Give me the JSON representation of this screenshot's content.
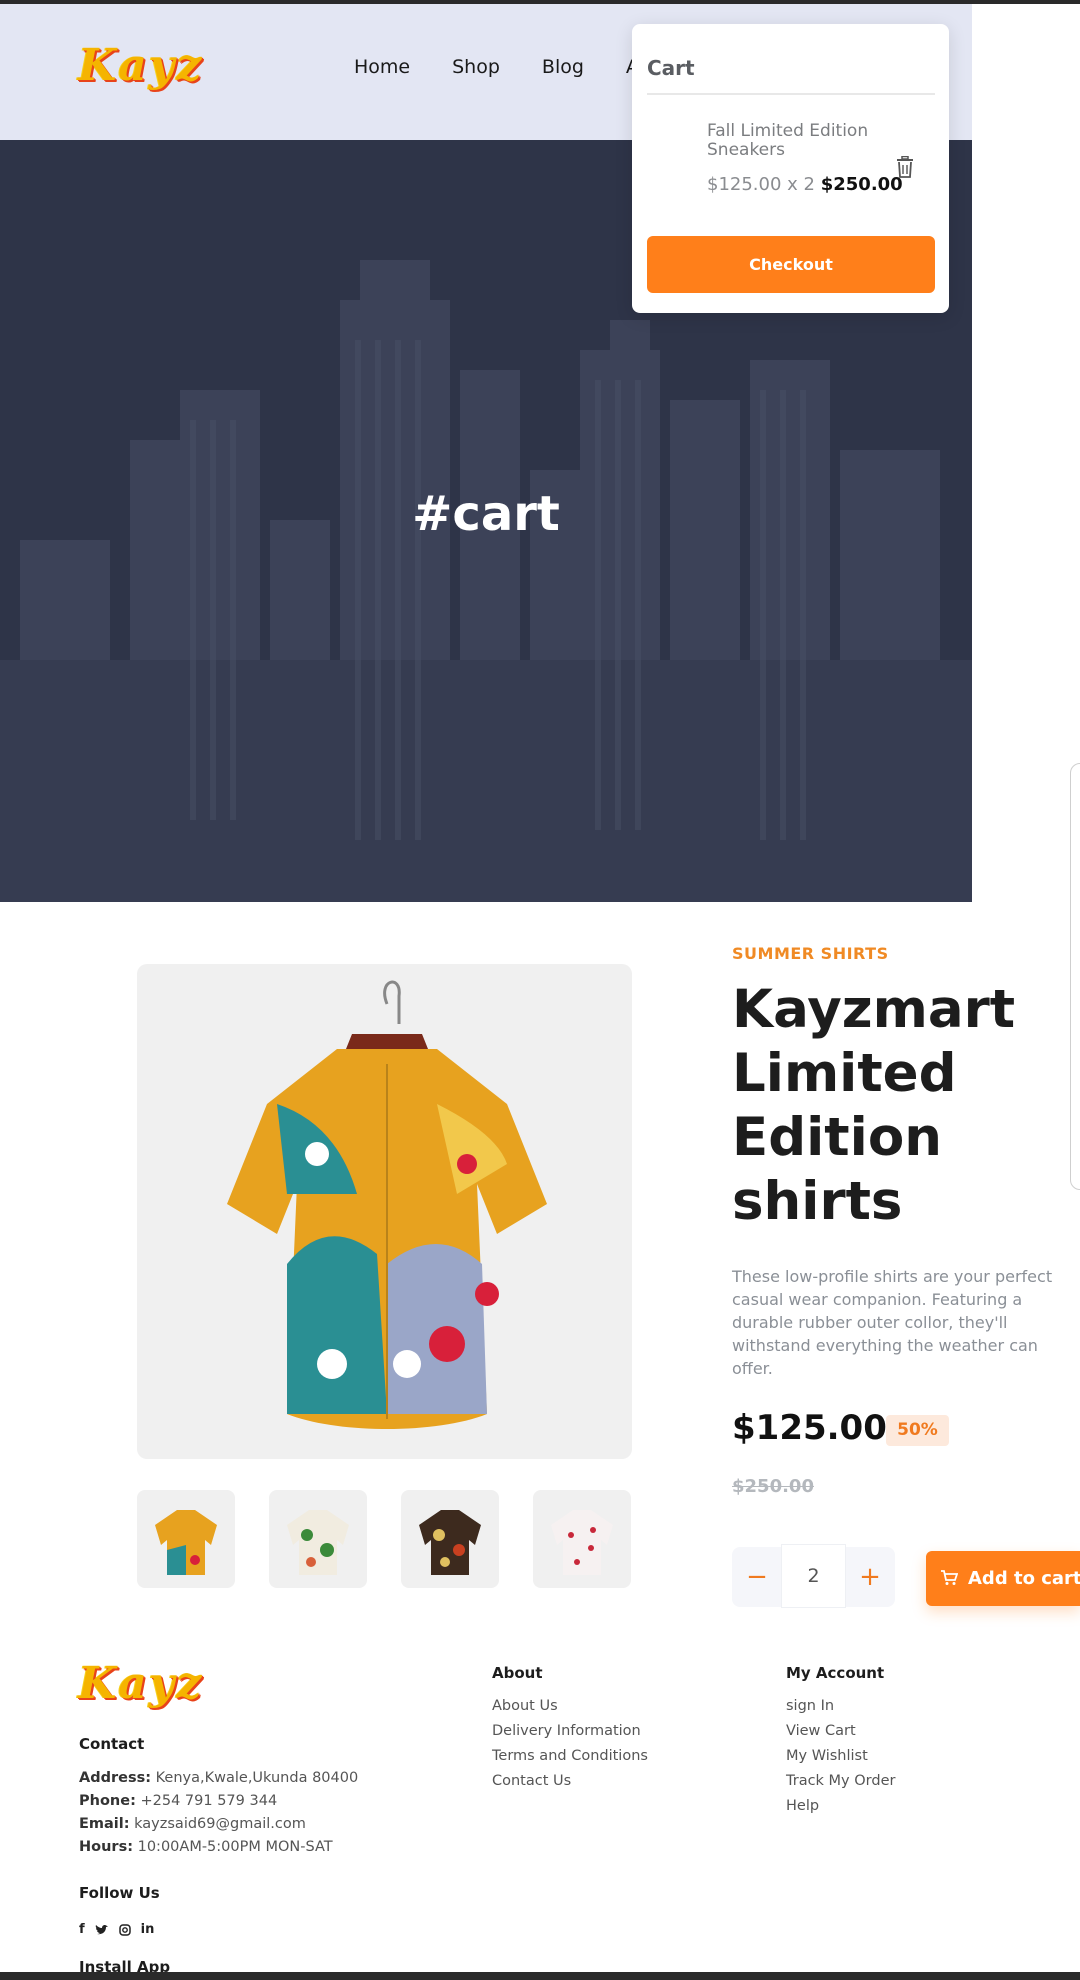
{
  "brand": {
    "logo_text": "Kayz"
  },
  "nav": {
    "items": [
      "Home",
      "Shop",
      "Blog",
      "About"
    ]
  },
  "hero": {
    "title": "#cart"
  },
  "cart": {
    "title": "Cart",
    "item_name": "Fall Limited Edition Sneakers",
    "item_unit": "$125.00 x 2",
    "item_total": "$250.00",
    "checkout_label": "Checkout"
  },
  "product": {
    "category": "SUMMER SHIRTS",
    "title": "Kayzmart Limited Edition shirts",
    "description": "These low-profile shirts are your perfect casual wear companion. Featuring a durable rubber outer collor, they'll withstand everything the weather can offer.",
    "price": "$125.00",
    "discount": "50%",
    "old_price": "$250.00",
    "quantity": "2",
    "add_to_cart_label": "Add to cart",
    "thumbnails": [
      "colorful-shirt-icon",
      "green-leaf-shirt-icon",
      "dark-floral-shirt-icon",
      "red-flower-shirt-icon"
    ]
  },
  "footer": {
    "contact": {
      "heading": "Contact",
      "address_label": "Address:",
      "address": "Kenya,Kwale,Ukunda 80400",
      "phone_label": "Phone:",
      "phone": "+254 791 579 344",
      "email_label": "Email:",
      "email": "kayzsaid69@gmail.com",
      "hours_label": "Hours:",
      "hours": "10:00AM-5:00PM MON-SAT"
    },
    "follow": {
      "heading": "Follow Us",
      "icons": [
        "facebook-icon",
        "twitter-icon",
        "instagram-icon",
        "linkedin-icon"
      ]
    },
    "install": {
      "heading": "Install App"
    },
    "about": {
      "heading": "About",
      "links": [
        "About Us",
        "Delivery Information",
        "Terms and Conditions",
        "Contact Us"
      ]
    },
    "account": {
      "heading": "My Account",
      "links": [
        "sign In",
        "View Cart",
        "My Wishlist",
        "Track My Order",
        "Help"
      ]
    }
  },
  "colors": {
    "accent": "#ff7f1a",
    "header_bg": "#e3e6f3",
    "hero_overlay": "#2c3144"
  }
}
